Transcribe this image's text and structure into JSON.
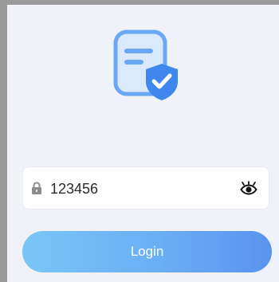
{
  "password": {
    "value": "123456",
    "lock_icon": "lock-icon",
    "visibility_icon": "eye-icon"
  },
  "login": {
    "label": "Login"
  },
  "colors": {
    "background": "#eff3f9",
    "accent": "#4a8ff5",
    "button_start": "#79c6f6",
    "button_end": "#5a92f0",
    "logo_light": "#cfe2fb",
    "logo_stroke": "#6aa8f5"
  }
}
